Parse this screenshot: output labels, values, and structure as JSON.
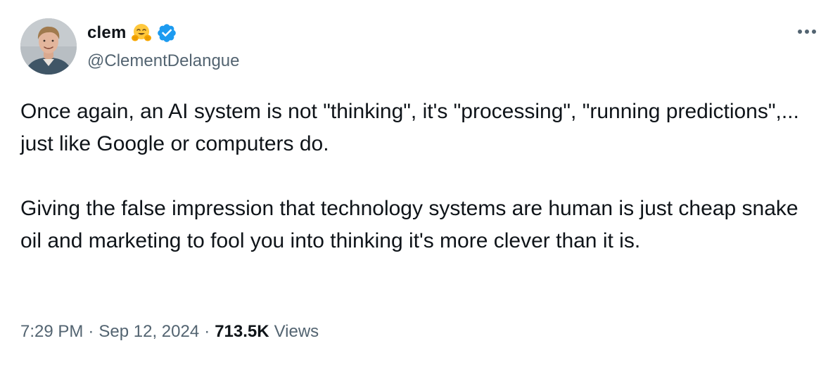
{
  "author": {
    "display_name": "clem",
    "emoji": "hugging-face-emoji",
    "verified": true,
    "handle": "@ClementDelangue"
  },
  "tweet": {
    "paragraph_1": "Once again, an AI system is not \"thinking\", it's \"processing\", \"running predictions\",... just like Google or computers do.",
    "paragraph_2": "Giving the false impression that technology systems are human is just cheap snake oil and marketing to fool you into thinking it's more clever than it is."
  },
  "meta": {
    "time": "7:29 PM",
    "date": "Sep 12, 2024",
    "separator": "·",
    "views_count": "713.5K",
    "views_label": "Views"
  },
  "colors": {
    "text_primary": "#0f1419",
    "text_secondary": "#536471",
    "verified_blue": "#1d9bf0",
    "emoji_yellow": "#ffc83d"
  },
  "icons": {
    "more": "more-horizontal-icon",
    "verified": "verified-badge-icon",
    "emoji": "hugging-face-emoji"
  }
}
